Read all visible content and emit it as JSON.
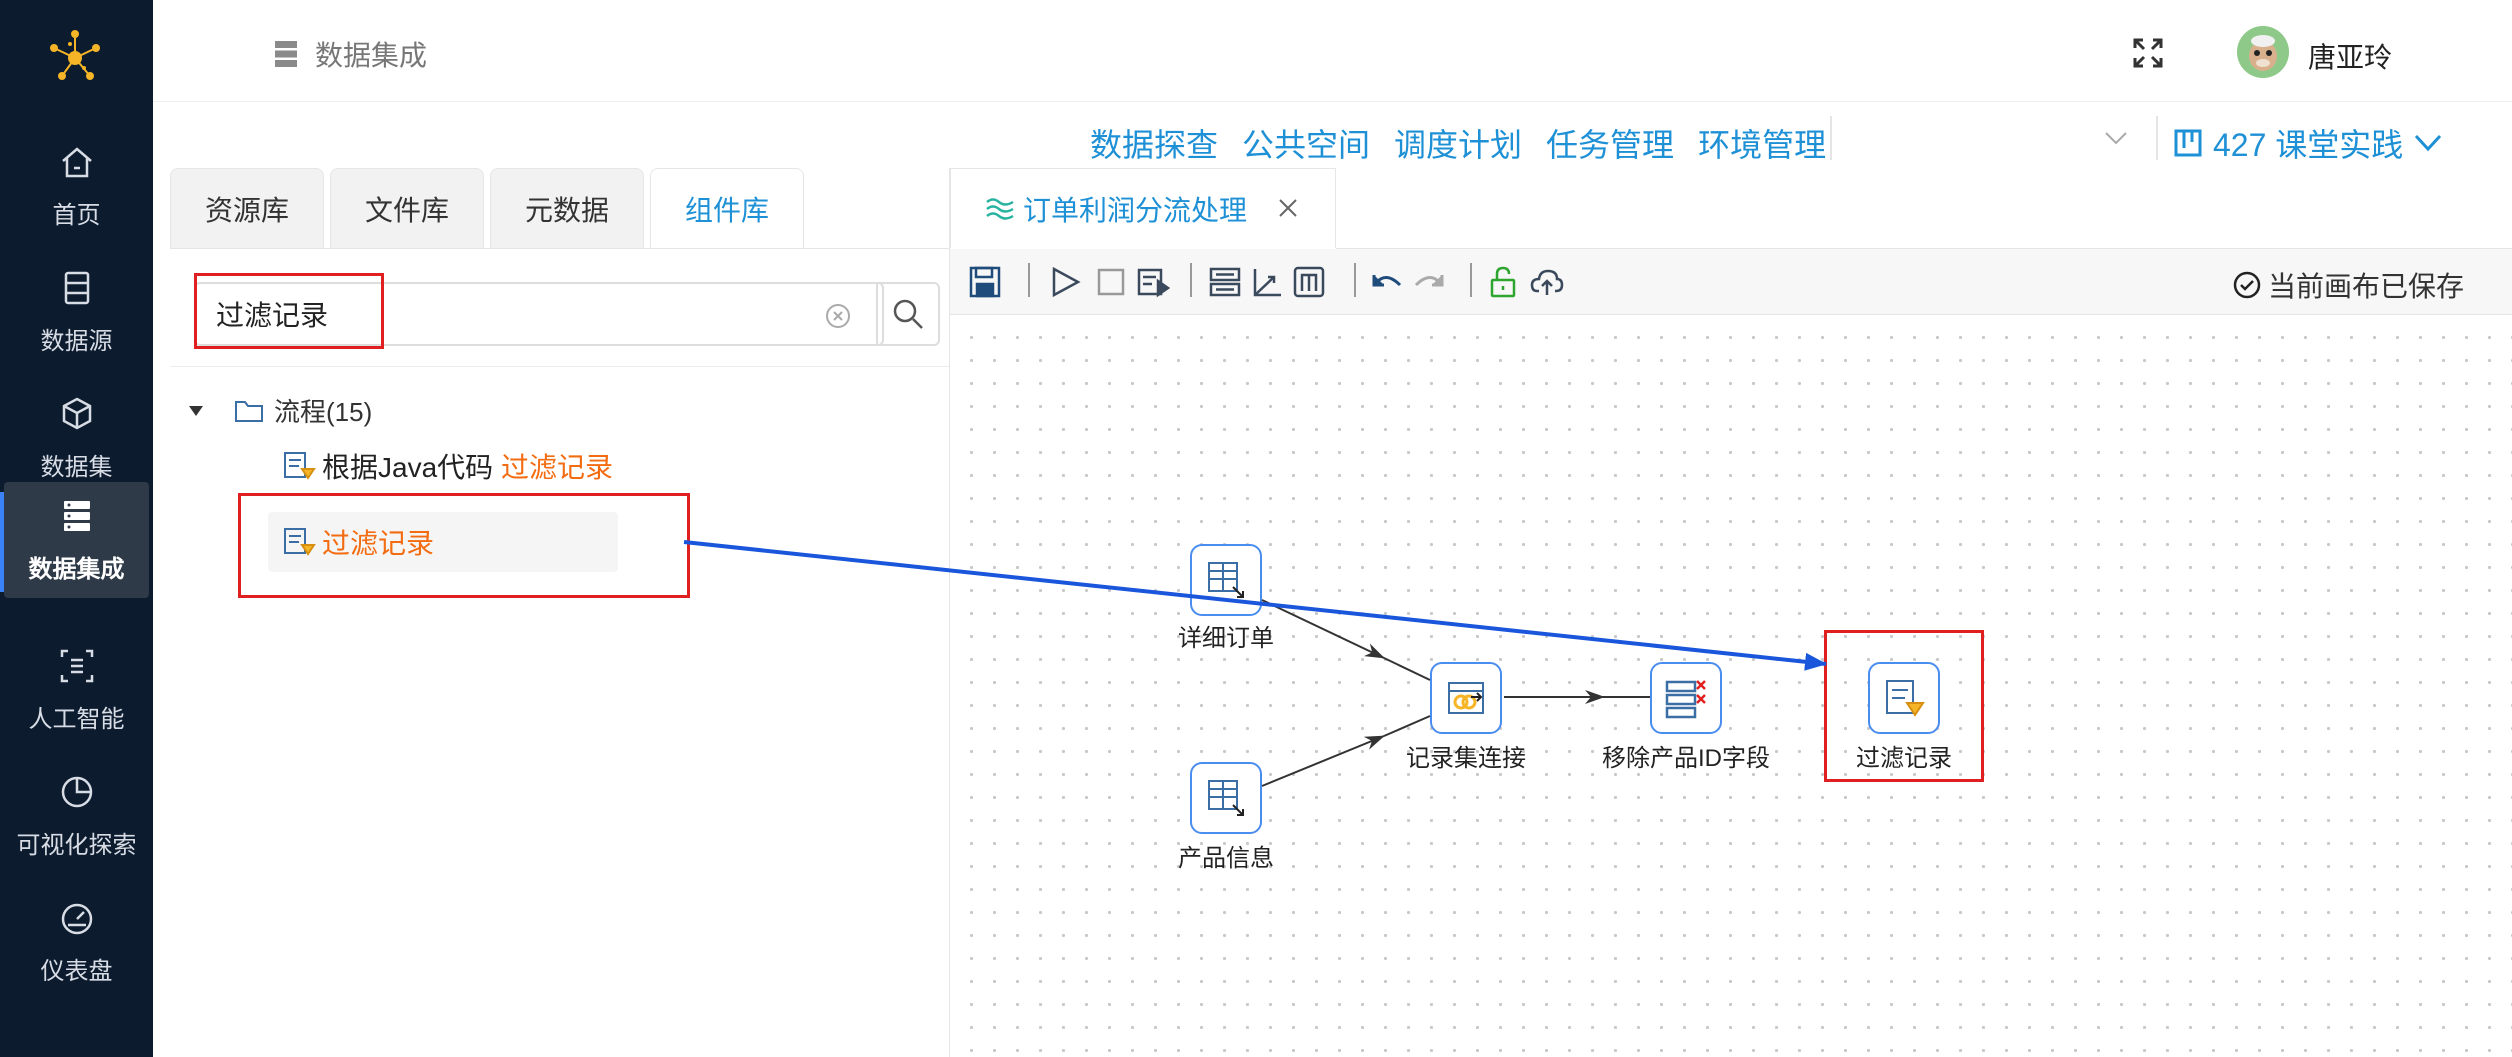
{
  "sidebar": {
    "items": [
      {
        "label": "首页",
        "icon": "home-icon"
      },
      {
        "label": "数据源",
        "icon": "datasource-icon"
      },
      {
        "label": "数据集",
        "icon": "dataset-cube-icon"
      },
      {
        "label": "数据集成",
        "icon": "integration-server-icon",
        "active": true
      },
      {
        "label": "人工智能",
        "icon": "ai-icon"
      },
      {
        "label": "可视化探索",
        "icon": "pie-chart-icon"
      },
      {
        "label": "仪表盘",
        "icon": "gauge-icon"
      }
    ]
  },
  "header": {
    "title": "数据集成",
    "username": "唐亚玲"
  },
  "menu": {
    "links": [
      "数据探查",
      "公共空间",
      "调度计划",
      "任务管理",
      "环境管理"
    ],
    "project": "427 课堂实践"
  },
  "left_panel": {
    "tabs": [
      "资源库",
      "文件库",
      "元数据",
      "组件库"
    ],
    "active_tab": "组件库",
    "search_value": "过滤记录",
    "tree_root": "流程(15)",
    "items": [
      {
        "prefix": "根据Java代码 ",
        "match": "过滤记录"
      },
      {
        "prefix": "",
        "match": "过滤记录"
      }
    ]
  },
  "editor": {
    "tab_title": "订单利润分流处理",
    "save_status": "当前画布已保存",
    "nodes": [
      {
        "id": "detail_order",
        "label": "详细订单"
      },
      {
        "id": "product_info",
        "label": "产品信息"
      },
      {
        "id": "record_join",
        "label": "记录集连接"
      },
      {
        "id": "remove_field",
        "label": "移除产品ID字段"
      },
      {
        "id": "filter_record",
        "label": "过滤记录"
      }
    ]
  },
  "colors": {
    "accent": "#1e90d6",
    "highlight_text": "#f36c11",
    "annotation_red": "#e02020",
    "annotation_arrow": "#1a56db",
    "sidebar_bg": "#0c1b2e"
  }
}
